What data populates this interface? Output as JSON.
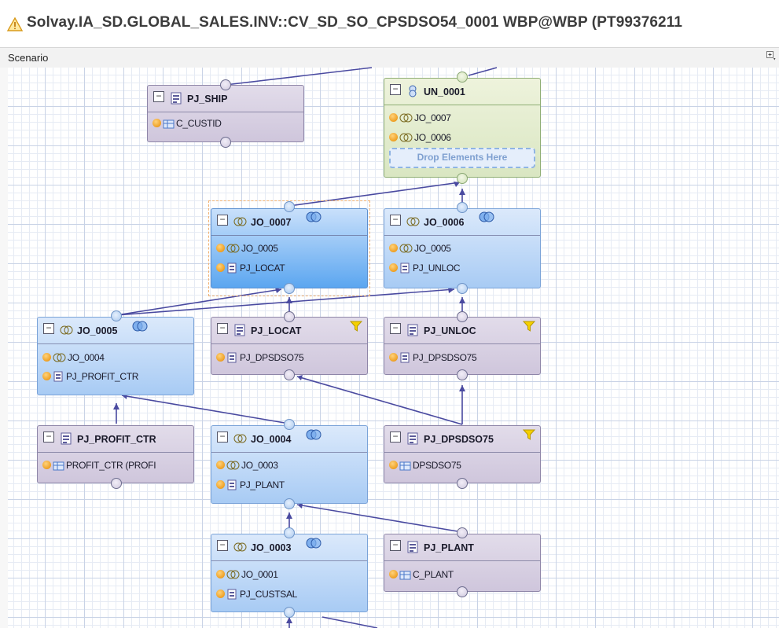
{
  "window": {
    "title": "Solvay.IA_SD.GLOBAL_SALES.INV::CV_SD_SO_CPSDSO54_0001 WBP@WBP (PT99376211",
    "warning_icon": "warning-triangle-icon"
  },
  "toolbar": {
    "scenario_label": "Scenario",
    "expand_icon": "expand-all-icon"
  },
  "colors": {
    "projection": "#cfc6dc",
    "join": "#a8cbf4",
    "union": "#d9e6c2",
    "selected_join": "#5ba6f0",
    "connector": "#4a4aa0",
    "output_dot": "#f0a020",
    "filter": "#f5d000"
  },
  "nodes": {
    "pj_ship": {
      "name": "PJ_SHIP",
      "type": "projection",
      "inputs": [
        "C_CUSTID"
      ]
    },
    "un_0001": {
      "name": "UN_0001",
      "type": "union",
      "inputs": [
        "JO_0007",
        "JO_0006"
      ],
      "drop_label": "Drop Elements Here"
    },
    "jo_0007": {
      "name": "JO_0007",
      "type": "join",
      "selected": true,
      "inputs": [
        "JO_0005",
        "PJ_LOCAT"
      ]
    },
    "jo_0006": {
      "name": "JO_0006",
      "type": "join",
      "inputs": [
        "JO_0005",
        "PJ_UNLOC"
      ]
    },
    "jo_0005": {
      "name": "JO_0005",
      "type": "join",
      "inputs": [
        "JO_0004",
        "PJ_PROFIT_CTR"
      ]
    },
    "pj_locat": {
      "name": "PJ_LOCAT",
      "type": "projection",
      "filter": true,
      "inputs": [
        "PJ_DPSDSO75"
      ]
    },
    "pj_unloc": {
      "name": "PJ_UNLOC",
      "type": "projection",
      "filter": true,
      "inputs": [
        "PJ_DPSDSO75"
      ]
    },
    "pj_profit_ctr": {
      "name": "PJ_PROFIT_CTR",
      "type": "projection",
      "inputs": [
        "PROFIT_CTR (PROFI"
      ]
    },
    "jo_0004": {
      "name": "JO_0004",
      "type": "join",
      "inputs": [
        "JO_0003",
        "PJ_PLANT"
      ]
    },
    "pj_dpsdso75": {
      "name": "PJ_DPSDSO75",
      "type": "projection",
      "filter": true,
      "inputs": [
        "DPSDSO75"
      ]
    },
    "jo_0003": {
      "name": "JO_0003",
      "type": "join",
      "inputs": [
        "JO_0001",
        "PJ_CUSTSAL"
      ]
    },
    "pj_plant": {
      "name": "PJ_PLANT",
      "type": "projection",
      "inputs": [
        "C_PLANT"
      ]
    }
  }
}
